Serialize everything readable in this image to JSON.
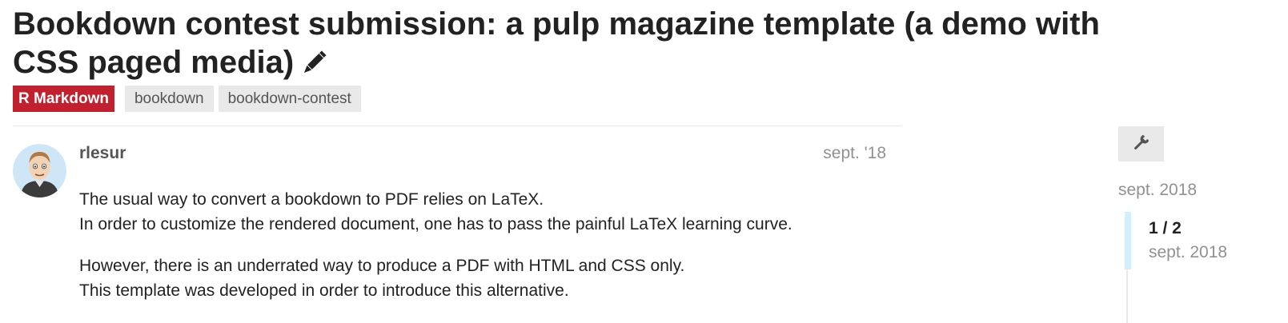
{
  "topic": {
    "title": "Bookdown contest submission: a pulp magazine template (a demo with CSS paged media)",
    "category": "R Markdown",
    "tags": [
      "bookdown",
      "bookdown-contest"
    ]
  },
  "post": {
    "username": "rlesur",
    "date": "sept. '18",
    "paragraphs": [
      {
        "line1": "The usual way to convert a bookdown to PDF relies on LaTeX.",
        "line2": "In order to customize the rendered document, one has to pass the painful LaTeX learning curve."
      },
      {
        "line1": "However, there is an underrated way to produce a PDF with HTML and CSS only.",
        "line2": "This template was developed in order to introduce this alternative."
      }
    ]
  },
  "timeline": {
    "start_date": "sept. 2018",
    "position": "1 / 2",
    "current_date": "sept. 2018"
  },
  "icons": {
    "edit": "pencil-icon",
    "admin": "wrench-icon"
  },
  "colors": {
    "category": "#c1202e",
    "tag_bg": "#e9e9e9",
    "timeline_handle": "#d1f0ff",
    "muted_text": "#919191"
  }
}
